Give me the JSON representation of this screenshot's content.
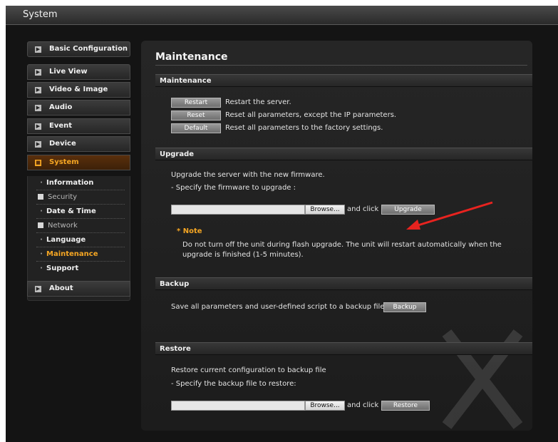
{
  "window": {
    "title": "System"
  },
  "sidebar": {
    "basic_config": "Basic Configuration",
    "items": [
      {
        "label": "Live View"
      },
      {
        "label": "Video & Image"
      },
      {
        "label": "Audio"
      },
      {
        "label": "Event"
      },
      {
        "label": "Device"
      },
      {
        "label": "System"
      }
    ],
    "system_sub": [
      {
        "label": "Information"
      },
      {
        "label": "Security"
      },
      {
        "label": "Date & Time"
      },
      {
        "label": "Network"
      },
      {
        "label": "Language"
      },
      {
        "label": "Maintenance"
      },
      {
        "label": "Support"
      }
    ],
    "about": "About",
    "expand_glyph": "▶",
    "active_item": "System",
    "active_sub_item": "Maintenance"
  },
  "main": {
    "page_title": "Maintenance",
    "maintenance": {
      "header": "Maintenance",
      "rows": [
        {
          "button": "Restart",
          "description": "Restart the server."
        },
        {
          "button": "Reset",
          "description": "Reset all parameters, except the IP parameters."
        },
        {
          "button": "Default",
          "description": "Reset all parameters to the factory settings."
        }
      ]
    },
    "upgrade": {
      "header": "Upgrade",
      "intro": "Upgrade the server with the new firmware.",
      "instruction": "- Specify the firmware to upgrade :",
      "browse_label": "Browse...",
      "and_click": "and click",
      "button": "Upgrade",
      "note_title": "* Note",
      "note_text": "Do not turn off the unit during flash upgrade. The unit will restart automatically when the upgrade is finished (1-5 minutes)."
    },
    "backup": {
      "header": "Backup",
      "text": "Save all parameters and user-defined script to a backup file.",
      "button": "Backup"
    },
    "restore": {
      "header": "Restore",
      "intro": "Restore current configuration to backup file",
      "instruction": "- Specify the backup file to restore:",
      "browse_label": "Browse...",
      "and_click": "and click",
      "button": "Restore"
    }
  },
  "colors": {
    "accent": "#f5a623",
    "annotation_arrow": "#e8231f",
    "background": "#141414"
  }
}
